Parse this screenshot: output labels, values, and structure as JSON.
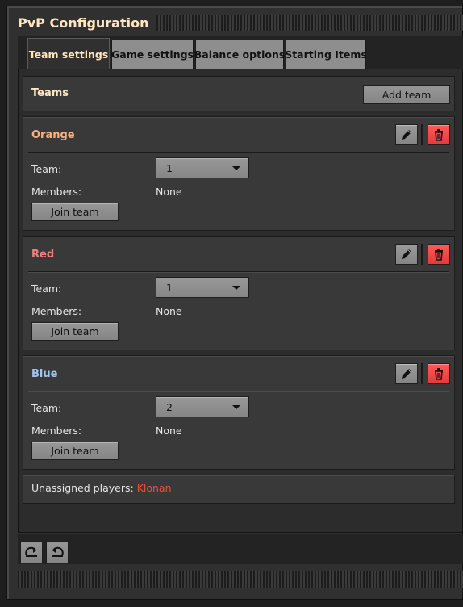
{
  "window": {
    "title": "PvP Configuration"
  },
  "tabs": [
    {
      "label": "Team settings"
    },
    {
      "label": "Game settings"
    },
    {
      "label": "Balance options"
    },
    {
      "label": "Starting Items"
    }
  ],
  "teams_header": {
    "title": "Teams",
    "add_button": "Add team"
  },
  "teams": [
    {
      "name": "Orange",
      "color": "#f4b183",
      "team_label": "Team:",
      "team_value": "1",
      "members_label": "Members:",
      "members_value": "None",
      "join_label": "Join team"
    },
    {
      "name": "Red",
      "color": "#f08080",
      "team_label": "Team:",
      "team_value": "1",
      "members_label": "Members:",
      "members_value": "None",
      "join_label": "Join team"
    },
    {
      "name": "Blue",
      "color": "#9fc5f0",
      "team_label": "Team:",
      "team_value": "2",
      "members_label": "Members:",
      "members_value": "None",
      "join_label": "Join team"
    }
  ],
  "unassigned": {
    "label": "Unassigned players:",
    "players": "Klonan",
    "player_color": "#e8503a"
  },
  "icons": {
    "edit": "pencil-icon",
    "delete": "trash-icon",
    "redo": "redo-icon",
    "undo": "undo-icon"
  }
}
